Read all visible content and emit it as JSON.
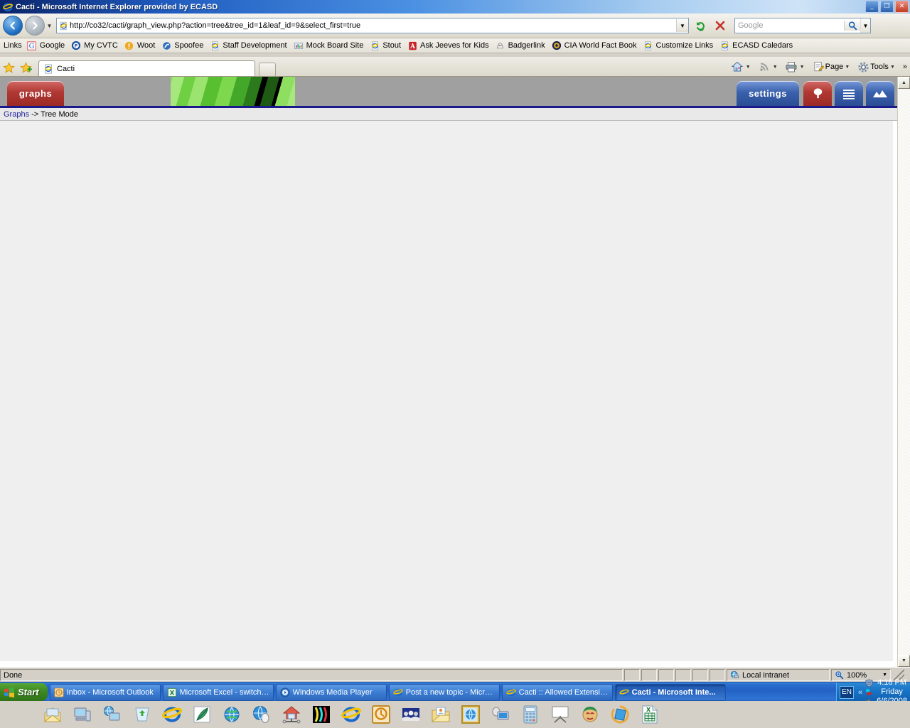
{
  "window": {
    "title": "Cacti - Microsoft Internet Explorer provided by ECASD",
    "minimize": "_",
    "restore": "❐",
    "close": "✕"
  },
  "address_bar": {
    "back_glyph": "←",
    "forward_glyph": "→",
    "history_dropdown": "▼",
    "url": "http://co32/cacti/graph_view.php?action=tree&tree_id=1&leaf_id=9&select_first=true",
    "url_dropdown": "▼",
    "refresh_label": "Refresh",
    "stop_label": "Stop",
    "search_placeholder": "Google",
    "search_dropdown": "▼"
  },
  "links_bar": {
    "label": "Links",
    "items": [
      {
        "label": "Google",
        "icon": "google-icon"
      },
      {
        "label": "My CVTC",
        "icon": "cvtc-icon"
      },
      {
        "label": "Woot",
        "icon": "woot-icon"
      },
      {
        "label": "Spoofee",
        "icon": "spoofee-icon"
      },
      {
        "label": "Staff Development",
        "icon": "ie-page-icon"
      },
      {
        "label": "Mock Board Site",
        "icon": "chart-icon"
      },
      {
        "label": "Stout",
        "icon": "ie-page-icon"
      },
      {
        "label": "Ask Jeeves for Kids",
        "icon": "askjeeves-icon"
      },
      {
        "label": "Badgerlink",
        "icon": "badgerlink-icon"
      },
      {
        "label": "CIA World Fact Book",
        "icon": "cia-icon"
      },
      {
        "label": "Customize Links",
        "icon": "ie-page-icon"
      },
      {
        "label": "ECASD Caledars",
        "icon": "ie-page-icon"
      }
    ]
  },
  "tabs": {
    "favorites_star": "★",
    "add_favorites": "★",
    "open_tab": "Cacti",
    "new_tab_tooltip": "New Tab"
  },
  "command_bar": {
    "home": "Home",
    "feeds": "Feeds",
    "print": "Print",
    "page": "Page",
    "tools": "Tools",
    "overflow": "»",
    "arrow": "▼"
  },
  "cacti": {
    "tab_graphs": "graphs",
    "tab_settings": "settings",
    "tab_tree_icon": "tree-icon",
    "tab_list_icon": "list-icon",
    "tab_graph_icon": "mountains-icon",
    "breadcrumb_link": "Graphs",
    "breadcrumb_sep": "->",
    "breadcrumb_current": "Tree Mode",
    "accent_blue": "#1a1a8c",
    "tab_red": "#b03833",
    "tab_blue": "#3a61ad",
    "header_gray": "#a0a0a0"
  },
  "scrollbar": {
    "up": "▲",
    "down": "▼"
  },
  "status_bar": {
    "message": "Done",
    "zone": "Local intranet",
    "zone_icon": "globe-icon",
    "zoom": "100%",
    "zoom_icon": "zoom-icon",
    "zoom_dropdown": "▼"
  },
  "taskbar": {
    "start": "Start",
    "buttons": [
      {
        "label": "Inbox - Microsoft Outlook",
        "icon": "outlook-icon",
        "active": false
      },
      {
        "label": "Microsoft Excel - switche...",
        "icon": "excel-icon",
        "active": false
      },
      {
        "label": "Windows Media Player",
        "icon": "wmp-icon",
        "active": false
      },
      {
        "label": "Post a new topic - Micros...",
        "icon": "ie-icon",
        "active": false
      },
      {
        "label": "Cacti :: Allowed Extensio...",
        "icon": "ie-icon",
        "active": false
      },
      {
        "label": "Cacti - Microsoft Inte...",
        "icon": "ie-icon",
        "active": true
      }
    ],
    "language": "EN",
    "tray_expand": "«",
    "time": "4:18 PM",
    "day": "Friday",
    "date": "6/6/2008"
  },
  "quick_launch": {
    "icons": [
      "mail-open-icon",
      "computer-icon",
      "network-computer-icon",
      "recycle-icon",
      "internet-explorer-icon",
      "feather-editor-icon",
      "globe-browser-icon",
      "globe-mouse-icon",
      "home-network-icon",
      "faces-icon",
      "internet-explorer-icon",
      "outlook-clock-icon",
      "people-banner-icon",
      "folder-mail-icon",
      "globe-frame-icon",
      "remote-desktop-icon",
      "calculator-icon",
      "presentation-icon",
      "face-paint-icon",
      "media-spin-icon",
      "excel-doc-icon"
    ]
  }
}
